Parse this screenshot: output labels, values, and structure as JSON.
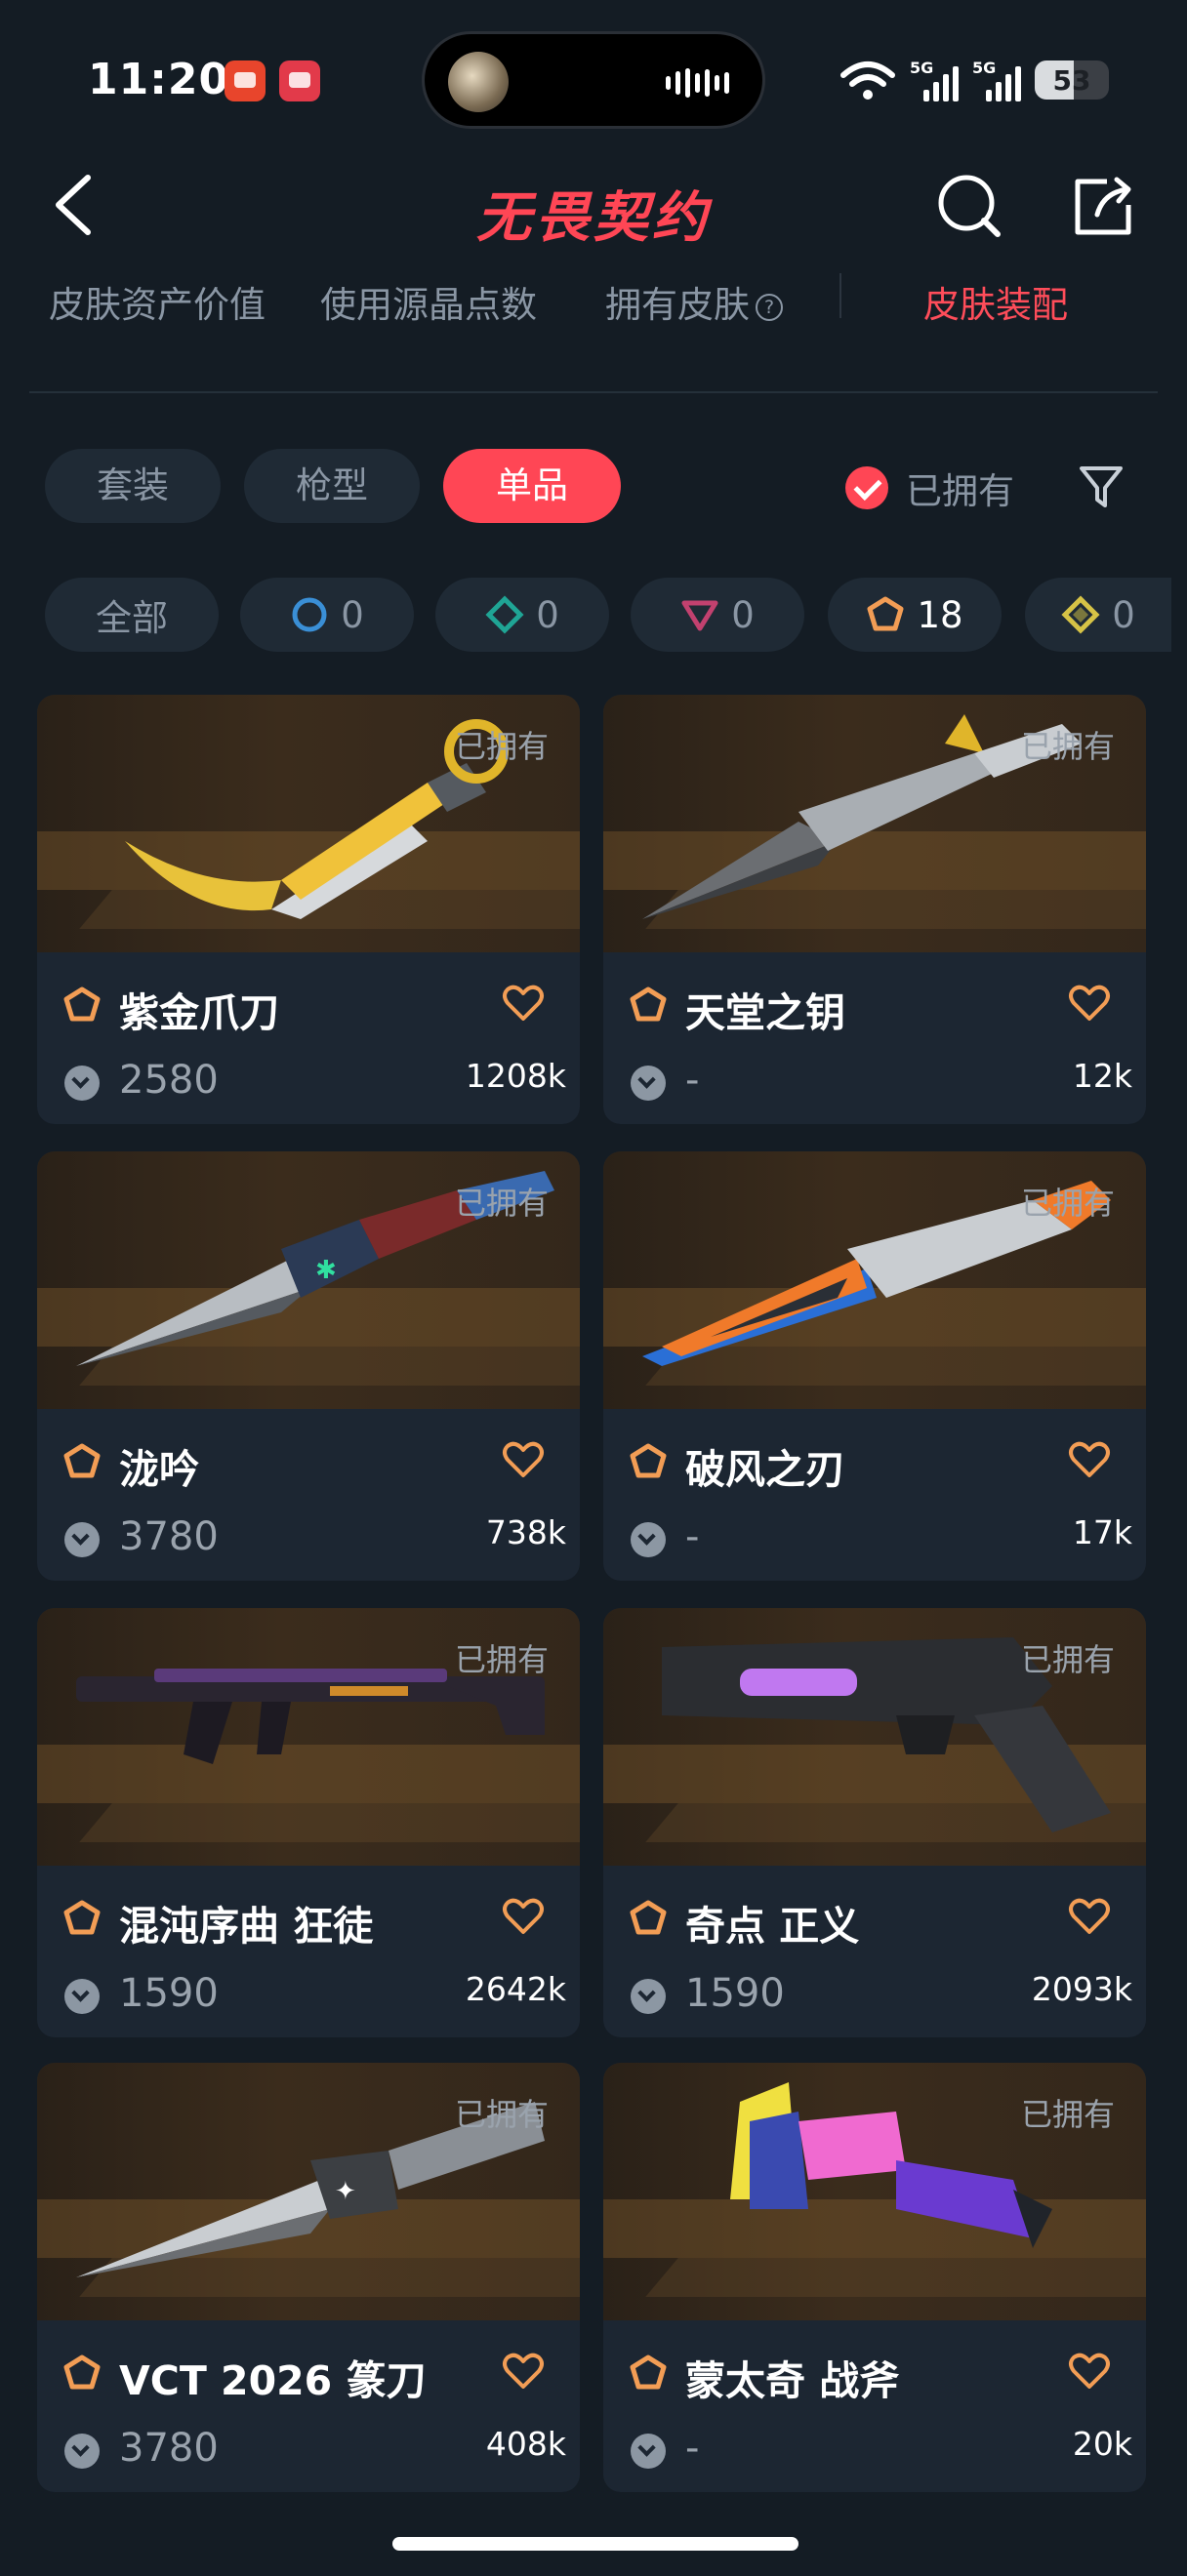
{
  "status_bar": {
    "time": "11:20",
    "signal_1": "5G",
    "signal_2": "5G",
    "battery": "53"
  },
  "header": {
    "title": "无畏契约"
  },
  "top_tabs": [
    {
      "label": "皮肤资产价值"
    },
    {
      "label": "使用源晶点数"
    },
    {
      "label": "拥有皮肤"
    },
    {
      "label": "皮肤装配"
    }
  ],
  "type_filter": [
    {
      "label": "套装"
    },
    {
      "label": "枪型"
    },
    {
      "label": "单品"
    }
  ],
  "owned_toggle": {
    "label": "已拥有",
    "checked": true
  },
  "tier_filter": [
    {
      "label": "全部"
    },
    {
      "count": "0",
      "tier": "select",
      "color": "#3a8fd6"
    },
    {
      "count": "0",
      "tier": "deluxe",
      "color": "#1fa595"
    },
    {
      "count": "0",
      "tier": "premium",
      "color": "#c2416f"
    },
    {
      "count": "18",
      "tier": "exclusive",
      "color": "#f29d55"
    },
    {
      "count": "0",
      "tier": "ultra",
      "color": "#d6c346"
    }
  ],
  "cards": [
    {
      "name": "紫金爪刀",
      "price": "2580",
      "favorites": "1208k",
      "owned": "已拥有"
    },
    {
      "name": "天堂之钥",
      "price": "-",
      "favorites": "12k",
      "owned": "已拥有"
    },
    {
      "name": "泷吟",
      "price": "3780",
      "favorites": "738k",
      "owned": "已拥有"
    },
    {
      "name": "破风之刃",
      "price": "-",
      "favorites": "17k",
      "owned": "已拥有"
    },
    {
      "name": "混沌序曲 狂徒",
      "price": "1590",
      "favorites": "2642k",
      "owned": "已拥有"
    },
    {
      "name": "奇点 正义",
      "price": "1590",
      "favorites": "2093k",
      "owned": "已拥有"
    },
    {
      "name": "VCT 2026 篆刀",
      "price": "3780",
      "favorites": "408k",
      "owned": "已拥有"
    },
    {
      "name": "蒙太奇 战斧",
      "price": "-",
      "favorites": "20k",
      "owned": "已拥有"
    }
  ],
  "colors": {
    "background": "#141c24",
    "accent": "#ff4655",
    "card": "#1c2632",
    "exclusive_tier": "#f29d55"
  }
}
